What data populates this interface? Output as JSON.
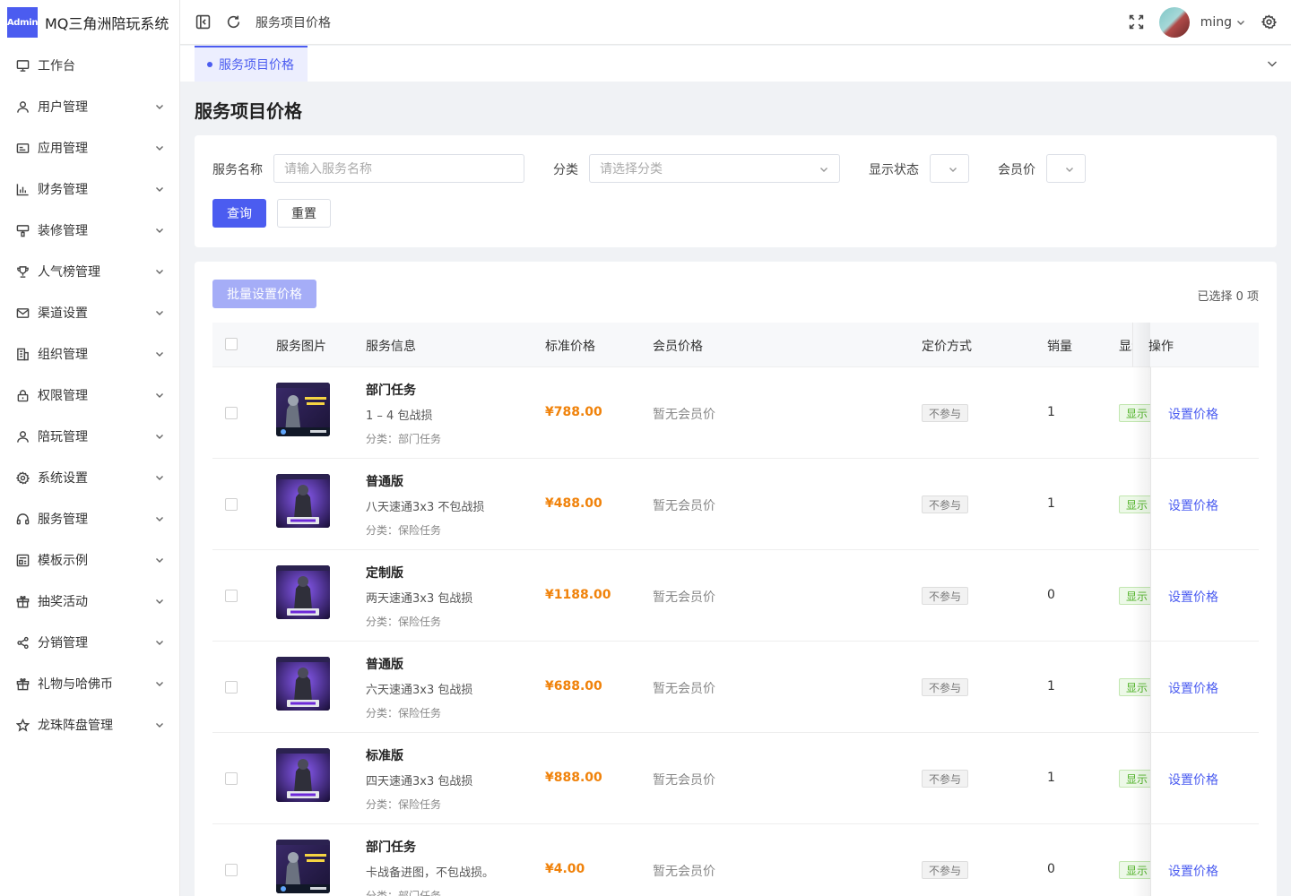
{
  "app": {
    "logo_badge": "Admin",
    "title": "MQ三角洲陪玩系统"
  },
  "sidebar": {
    "items": [
      {
        "label": "工作台",
        "icon": "monitor-icon",
        "has_children": false
      },
      {
        "label": "用户管理",
        "icon": "user-icon",
        "has_children": true
      },
      {
        "label": "应用管理",
        "icon": "app-icon",
        "has_children": true
      },
      {
        "label": "财务管理",
        "icon": "chart-icon",
        "has_children": true
      },
      {
        "label": "装修管理",
        "icon": "paint-icon",
        "has_children": true
      },
      {
        "label": "人气榜管理",
        "icon": "trophy-icon",
        "has_children": true
      },
      {
        "label": "渠道设置",
        "icon": "mail-icon",
        "has_children": true
      },
      {
        "label": "组织管理",
        "icon": "building-icon",
        "has_children": true
      },
      {
        "label": "权限管理",
        "icon": "lock-icon",
        "has_children": true
      },
      {
        "label": "陪玩管理",
        "icon": "user-icon",
        "has_children": true
      },
      {
        "label": "系统设置",
        "icon": "gear-icon",
        "has_children": true
      },
      {
        "label": "服务管理",
        "icon": "headset-icon",
        "has_children": true
      },
      {
        "label": "模板示例",
        "icon": "template-icon",
        "has_children": true
      },
      {
        "label": "抽奖活动",
        "icon": "gift-icon",
        "has_children": true
      },
      {
        "label": "分销管理",
        "icon": "share-icon",
        "has_children": true
      },
      {
        "label": "礼物与哈佛币",
        "icon": "gift-icon",
        "has_children": true
      },
      {
        "label": "龙珠阵盘管理",
        "icon": "star-icon",
        "has_children": true
      }
    ]
  },
  "header": {
    "breadcrumb": "服务项目价格",
    "user_name": "ming"
  },
  "tabs": [
    {
      "label": "服务项目价格",
      "active": true
    }
  ],
  "page": {
    "title": "服务项目价格"
  },
  "filters": {
    "name_label": "服务名称",
    "name_placeholder": "请输入服务名称",
    "category_label": "分类",
    "category_placeholder": "请选择分类",
    "status_label": "显示状态",
    "member_label": "会员价",
    "query_button": "查询",
    "reset_button": "重置"
  },
  "table": {
    "batch_button": "批量设置价格",
    "selected_text": "已选择 0 项",
    "columns": {
      "image": "服务图片",
      "info": "服务信息",
      "price": "标准价格",
      "member": "会员价格",
      "pricing": "定价方式",
      "sales": "销量",
      "status": "显示状态",
      "action": "操作"
    },
    "rows": [
      {
        "name": "部门任务",
        "desc": "1 – 4 包战损",
        "category": "分类：部门任务",
        "price": "¥788.00",
        "member": "暂无会员价",
        "pricing": "不参与",
        "sales": "1",
        "status": "显示",
        "action": "设置价格",
        "thumb": "dept"
      },
      {
        "name": "普通版",
        "desc": "八天速通3x3 不包战损",
        "category": "分类：保险任务",
        "price": "¥488.00",
        "member": "暂无会员价",
        "pricing": "不参与",
        "sales": "1",
        "status": "显示",
        "action": "设置价格",
        "thumb": "insurance"
      },
      {
        "name": "定制版",
        "desc": "两天速通3x3 包战损",
        "category": "分类：保险任务",
        "price": "¥1188.00",
        "member": "暂无会员价",
        "pricing": "不参与",
        "sales": "0",
        "status": "显示",
        "action": "设置价格",
        "thumb": "insurance"
      },
      {
        "name": "普通版",
        "desc": "六天速通3x3 包战损",
        "category": "分类：保险任务",
        "price": "¥688.00",
        "member": "暂无会员价",
        "pricing": "不参与",
        "sales": "1",
        "status": "显示",
        "action": "设置价格",
        "thumb": "insurance"
      },
      {
        "name": "标准版",
        "desc": "四天速通3x3 包战损",
        "category": "分类：保险任务",
        "price": "¥888.00",
        "member": "暂无会员价",
        "pricing": "不参与",
        "sales": "1",
        "status": "显示",
        "action": "设置价格",
        "thumb": "insurance"
      },
      {
        "name": "部门任务",
        "desc": "卡战备进图，不包战损。",
        "category": "分类：部门任务",
        "price": "¥4.00",
        "member": "暂无会员价",
        "pricing": "不参与",
        "sales": "0",
        "status": "显示",
        "action": "设置价格",
        "thumb": "dept"
      }
    ]
  },
  "colors": {
    "primary": "#4b5cf0",
    "price": "#f0820a",
    "success": "#52b32a"
  }
}
